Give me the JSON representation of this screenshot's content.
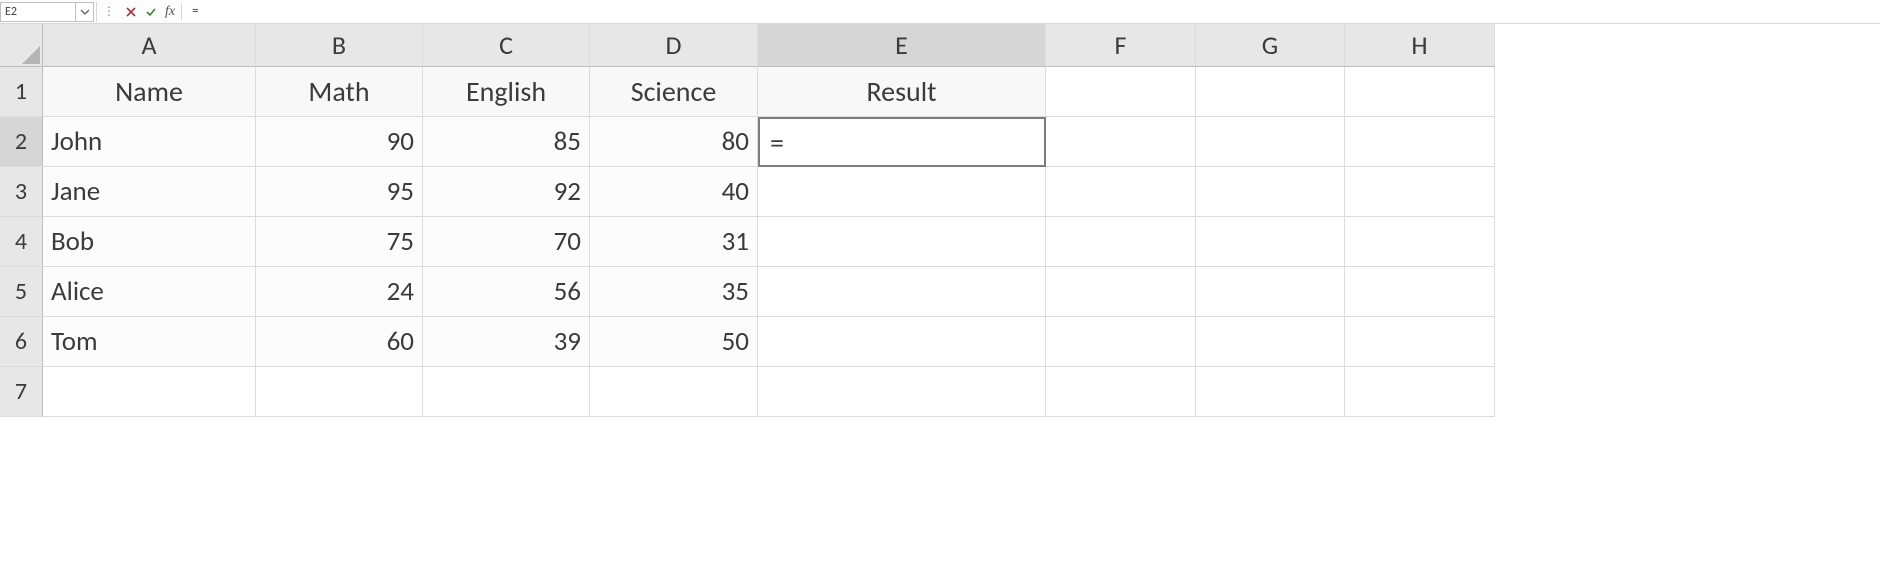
{
  "formula_bar": {
    "name_box_value": "E2",
    "fx_label": "fx",
    "formula_value": "=",
    "cancel_tooltip": "Cancel",
    "enter_tooltip": "Enter"
  },
  "grid": {
    "column_letters": [
      "A",
      "B",
      "C",
      "D",
      "E",
      "F",
      "G",
      "H"
    ],
    "row_numbers": [
      "1",
      "2",
      "3",
      "4",
      "5",
      "6",
      "7"
    ],
    "active_col_index": 4,
    "active_row_index": 1,
    "header_row": [
      "Name",
      "Math",
      "English",
      "Science",
      "Result",
      "",
      "",
      ""
    ],
    "rows": [
      {
        "name": "John",
        "math": "90",
        "english": "85",
        "science": "80",
        "result": "="
      },
      {
        "name": "Jane",
        "math": "95",
        "english": "92",
        "science": "40",
        "result": ""
      },
      {
        "name": "Bob",
        "math": "75",
        "english": "70",
        "science": "31",
        "result": ""
      },
      {
        "name": "Alice",
        "math": "24",
        "english": "56",
        "science": "35",
        "result": ""
      },
      {
        "name": "Tom",
        "math": "60",
        "english": "39",
        "science": "50",
        "result": ""
      }
    ],
    "editing_cell_value": "="
  }
}
